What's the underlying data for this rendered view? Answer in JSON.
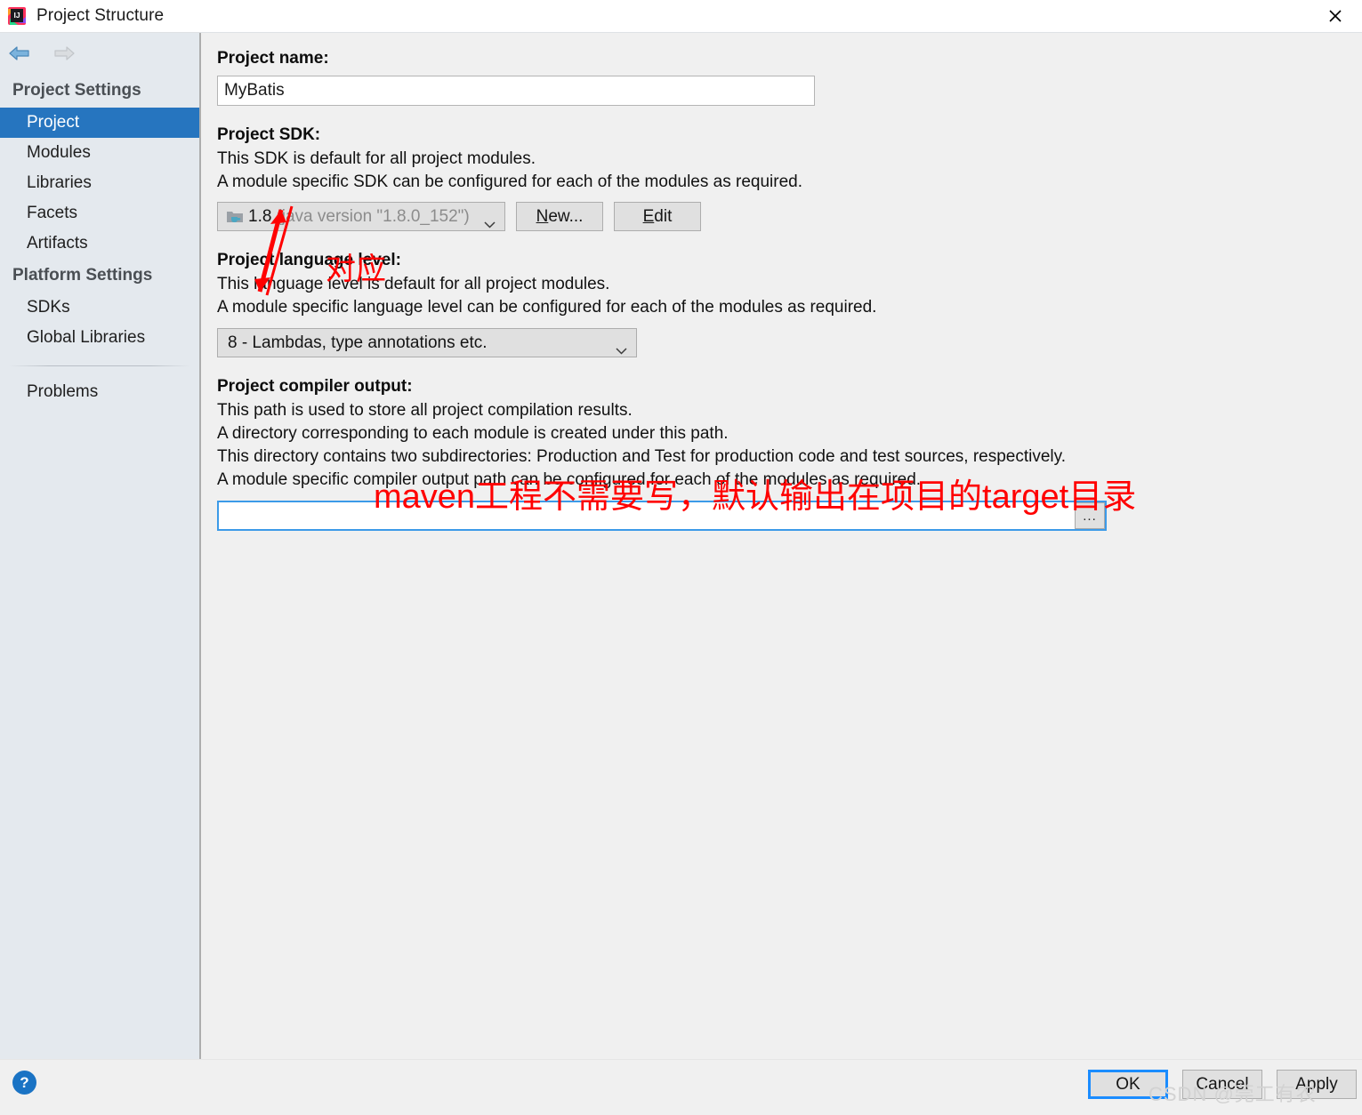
{
  "window": {
    "title": "Project Structure",
    "app_icon": "intellij-idea-icon",
    "close_icon": "close-icon"
  },
  "nav": {
    "back_icon": "arrow-left-icon",
    "forward_icon": "arrow-right-icon"
  },
  "sidebar": {
    "groups": [
      {
        "label": "Project Settings",
        "items": [
          {
            "label": "Project",
            "selected": true
          },
          {
            "label": "Modules",
            "selected": false
          },
          {
            "label": "Libraries",
            "selected": false
          },
          {
            "label": "Facets",
            "selected": false
          },
          {
            "label": "Artifacts",
            "selected": false
          }
        ]
      },
      {
        "label": "Platform Settings",
        "items": [
          {
            "label": "SDKs",
            "selected": false
          },
          {
            "label": "Global Libraries",
            "selected": false
          }
        ]
      }
    ],
    "problems": {
      "label": "Problems"
    }
  },
  "main": {
    "project_name": {
      "label": "Project name:",
      "value": "MyBatis"
    },
    "project_sdk": {
      "label": "Project SDK:",
      "desc_1": "This SDK is default for all project modules.",
      "desc_2": "A module specific SDK can be configured for each of the modules as required.",
      "selected_name": "1.8",
      "selected_version": "(java version \"1.8.0_152\")",
      "sdk_icon": "java-sdk-icon",
      "chevron_icon": "chevron-down-icon",
      "new_button": {
        "prefix": "",
        "accel": "N",
        "suffix": "ew..."
      },
      "edit_button": {
        "prefix": "",
        "accel": "E",
        "suffix": "dit"
      }
    },
    "language_level": {
      "label": "Project language level:",
      "desc_1": "This language level is default for all project modules.",
      "desc_2": "A module specific language level can be configured for each of the modules as required.",
      "selected": "8 - Lambdas, type annotations etc.",
      "chevron_icon": "chevron-down-icon"
    },
    "compiler_output": {
      "label": "Project compiler output:",
      "desc_1": "This path is used to store all project compilation results.",
      "desc_2": "A directory corresponding to each module is created under this path.",
      "desc_3": "This directory contains two subdirectories: Production and Test for production code and test sources, respectively.",
      "desc_4": "A module specific compiler output path can be configured for each of the modules as required.",
      "value": "",
      "browse_label": "...",
      "browse_icon": "ellipsis-browse-icon"
    }
  },
  "annotations": {
    "arrow_icon": "red-double-arrow-icon",
    "correspond_text": "对应",
    "maven_note": "maven工程不需要写，默认输出在项目的target目录",
    "color": "#ff0000"
  },
  "footer": {
    "help_label": "?",
    "help_icon": "help-icon",
    "ok_label": "OK",
    "cancel_label": "Cancel",
    "apply_label": "Apply"
  },
  "watermark": {
    "text": "CSDN @莞工有农"
  }
}
